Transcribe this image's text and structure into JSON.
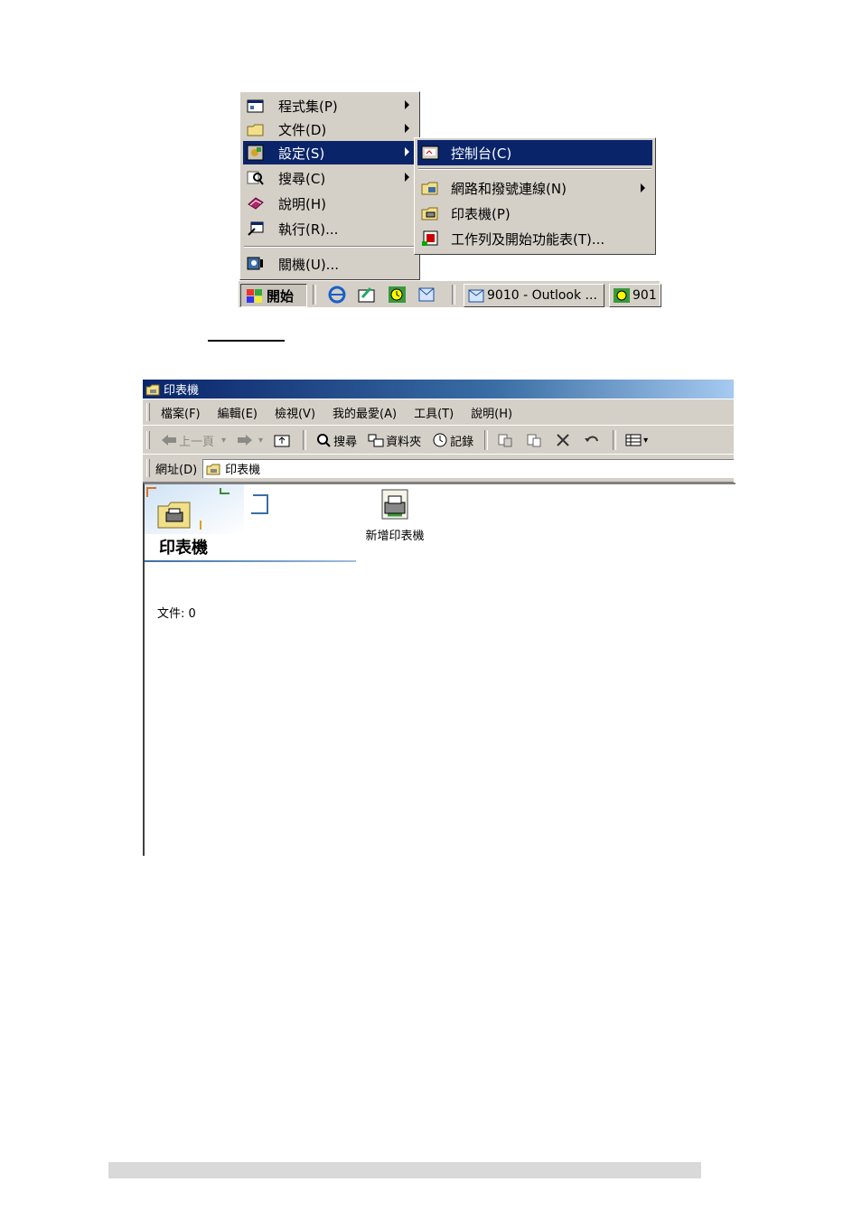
{
  "start_menu": {
    "items": [
      {
        "label": "程式集(P)",
        "has_submenu": true
      },
      {
        "label": "文件(D)",
        "has_submenu": true
      },
      {
        "label": "設定(S)",
        "has_submenu": true,
        "selected": true
      },
      {
        "label": "搜尋(C)",
        "has_submenu": true
      },
      {
        "label": "說明(H)",
        "has_submenu": false
      },
      {
        "label": "執行(R)...",
        "has_submenu": false
      }
    ],
    "shutdown_label": "關機(U)..."
  },
  "settings_submenu": {
    "items": [
      {
        "label": "控制台(C)",
        "selected": true
      },
      {
        "label": "網路和撥號連線(N)",
        "has_submenu": true
      },
      {
        "label": "印表機(P)"
      },
      {
        "label": "工作列及開始功能表(T)..."
      }
    ]
  },
  "taskbar": {
    "start_label": "開始",
    "tasks": [
      {
        "label": "9010 - Outlook ..."
      },
      {
        "label": "901"
      }
    ]
  },
  "window": {
    "title": "印表機",
    "menus": [
      "檔案(F)",
      "編輯(E)",
      "檢視(V)",
      "我的最愛(A)",
      "工具(T)",
      "說明(H)"
    ],
    "toolbar": {
      "back": "上一頁",
      "search": "搜尋",
      "folders": "資料夾",
      "history": "記錄"
    },
    "address": {
      "label": "網址(D)",
      "value": "印表機"
    },
    "hero_title": "印表機",
    "doc_count": "文件: 0",
    "items": [
      {
        "label": "新增印表機"
      }
    ]
  },
  "colors": {
    "menu_highlight": "#0a246a",
    "face": "#d4d0c8"
  }
}
